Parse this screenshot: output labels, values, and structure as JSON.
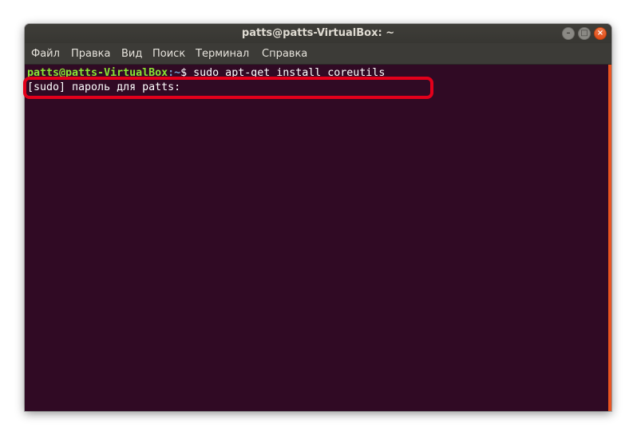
{
  "window": {
    "title": "patts@patts-VirtualBox: ~"
  },
  "menu": {
    "items": [
      "Файл",
      "Правка",
      "Вид",
      "Поиск",
      "Терминал",
      "Справка"
    ]
  },
  "terminal": {
    "prompt_user": "patts@patts-VirtualBox",
    "prompt_path": ":~",
    "prompt_symbol": "$ ",
    "command": "sudo apt-get install coreutils",
    "password_prompt": "[sudo] пароль для patts:"
  },
  "colors": {
    "terminal_bg": "#300a24",
    "prompt_user": "#8ae234",
    "prompt_path": "#729fcf",
    "highlight": "#e3001b",
    "scrollbar": "#e95420"
  },
  "icons": {
    "minimize": "minimize-icon",
    "maximize": "maximize-icon",
    "close": "close-icon"
  }
}
